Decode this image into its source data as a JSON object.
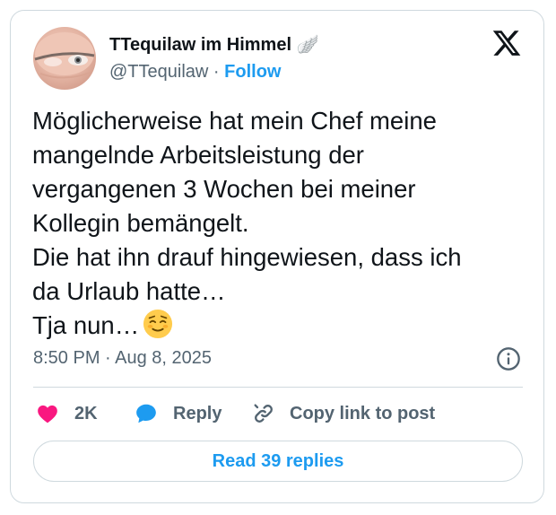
{
  "tweet": {
    "author_name": "TTequilaw im Himmel 🪽",
    "author_handle": "@TTequilaw",
    "handle_separator": "·",
    "follow_label": "Follow",
    "text": "Möglicherweise hat mein Chef meine\nmangelnde Arbeitsleistung der\nvergangenen 3 Wochen bei meiner\nKollegin bemängelt.\nDie hat ihn drauf hingewiesen, dass ich\nda Urlaub hatte…\nTja nun…",
    "emoji": "relieved-face",
    "timestamp": "8:50 PM · Aug 8, 2025"
  },
  "actions": {
    "like_count": "2K",
    "reply_label": "Reply",
    "copy_link_label": "Copy link to post"
  },
  "footer": {
    "read_replies_label": "Read 39 replies"
  },
  "colors": {
    "accent": "#1d9bf0",
    "like": "#f91880",
    "secondary_text": "#536471",
    "border": "#cfd9de"
  }
}
